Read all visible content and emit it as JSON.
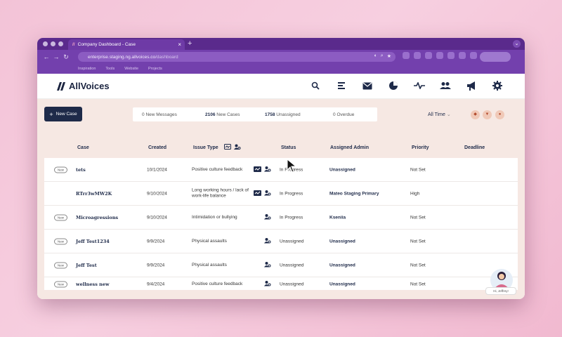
{
  "browser": {
    "tab_title": "Company Dashboard - Case",
    "url_host": "enterprise.staging.ng.allvoices.co",
    "url_path": "/dashboard",
    "bookmarks": [
      "Inspiration",
      "Tools",
      "Website",
      "Projects"
    ]
  },
  "app": {
    "brand": "AllVoices",
    "new_case_label": "New Case",
    "stats": {
      "new_messages": "0",
      "new_messages_label": "New Messages",
      "new_cases": "2106",
      "new_cases_label": "New Cases",
      "unassigned": "1758",
      "unassigned_label": "Unassigned",
      "overdue": "0",
      "overdue_label": "Overdue"
    },
    "time_filter": "All Time",
    "columns": {
      "case": "Case",
      "created": "Created",
      "issue_type": "Issue Type",
      "status": "Status",
      "assigned_admin": "Assigned Admin",
      "priority": "Priority",
      "deadline": "Deadline"
    },
    "rows": [
      {
        "badge": "New",
        "case": "tets",
        "created": "10/1/2024",
        "issue": "Positive culture feedback",
        "status": "In Progress",
        "admin": "Unassigned",
        "priority": "Not Set"
      },
      {
        "badge": "",
        "case": "RTrr3wMW2K",
        "created": "9/10/2024",
        "issue": "Long working hours / lack of work-life balance",
        "status": "In Progress",
        "admin": "Mateo Staging Primary",
        "priority": "High"
      },
      {
        "badge": "New",
        "case": "Microagressions",
        "created": "9/10/2024",
        "issue": "Intimidation or bullying",
        "status": "In Progress",
        "admin": "Kseniia",
        "priority": "Not Set"
      },
      {
        "badge": "New",
        "case": "Jeff Test1234",
        "created": "9/9/2024",
        "issue": "Physical assaults",
        "status": "Unassigned",
        "admin": "Unassigned",
        "priority": "Not Set"
      },
      {
        "badge": "New",
        "case": "Jeff Test",
        "created": "9/9/2024",
        "issue": "Physical assaults",
        "status": "Unassigned",
        "admin": "Unassigned",
        "priority": "Not Set"
      },
      {
        "badge": "New",
        "case": "wellness new",
        "created": "9/4/2024",
        "issue": "Positive culture feedback",
        "status": "Unassigned",
        "admin": "Unassigned",
        "priority": "Not Set"
      }
    ],
    "chat_greeting": "Hi, Jeffrey!"
  },
  "colors": {
    "navy": "#1e2a49",
    "purple": "#7340ad",
    "peach": "#f6e8e3"
  }
}
